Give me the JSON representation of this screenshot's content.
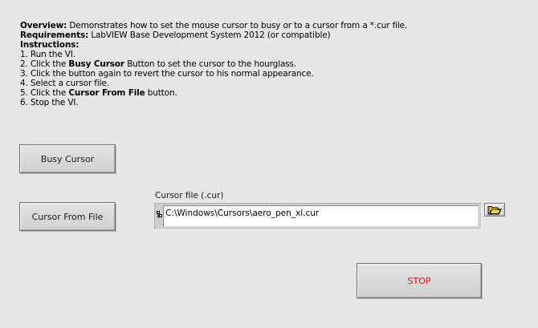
{
  "description": {
    "overview_label": "Overview:",
    "overview_text": " Demonstrates how to set the mouse cursor to busy or to a cursor from a *.cur file.",
    "requirements_label": "Requirements:",
    "requirements_text": " LabVIEW Base Development System 2012 (or compatible)",
    "instructions_label": "Instructions:",
    "step1": "1. Run the VI.",
    "step2_pre": "2. Click the ",
    "step2_bold": "Busy Cursor",
    "step2_post": " Button to set the cursor to the hourglass.",
    "step3": "3. Click the button again to revert the cursor to his normal appearance.",
    "step4": "4. Select a cursor file.",
    "step5_pre": "5. Click the ",
    "step5_bold": "Cursor From File",
    "step5_post": " button.",
    "step6": "6. Stop the VI."
  },
  "buttons": {
    "busy_cursor": "Busy Cursor",
    "cursor_from_file": "Cursor From File",
    "stop": "STOP"
  },
  "cursor_file": {
    "label": "Cursor file (.cur)",
    "value": "C:\\Windows\\Cursors\\aero_pen_xl.cur"
  },
  "icons": {
    "browse": "folder-open-icon",
    "path_menu": "path-menu-icon"
  },
  "colors": {
    "panel_background": "#e6e6e6",
    "stop_text": "#e0140e"
  }
}
